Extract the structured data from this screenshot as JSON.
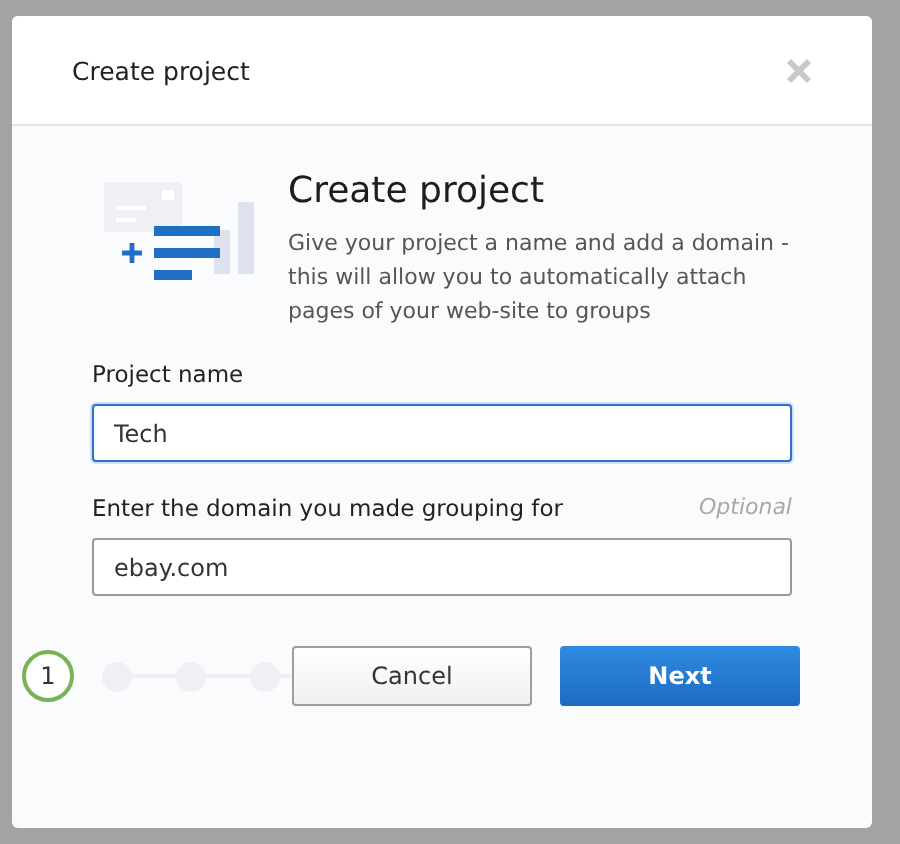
{
  "dialog": {
    "title": "Create project"
  },
  "intro": {
    "heading": "Create project",
    "text": "Give your project a name and add a domain - this will allow you to automatically attach pages of your web-site to groups"
  },
  "fields": [
    {
      "label": "Project name",
      "value": "Tech",
      "focused": true
    },
    {
      "label": "Enter the domain you made grouping for",
      "hint": "Optional",
      "value": "ebay.com",
      "focused": false
    }
  ],
  "steps": [
    {
      "label": "1",
      "current": true
    },
    {
      "current": false
    },
    {
      "current": false
    },
    {
      "current": false
    }
  ],
  "buttons": [
    {
      "label": "Cancel",
      "kind": "secondary"
    },
    {
      "label": "Next",
      "kind": "primary"
    }
  ]
}
